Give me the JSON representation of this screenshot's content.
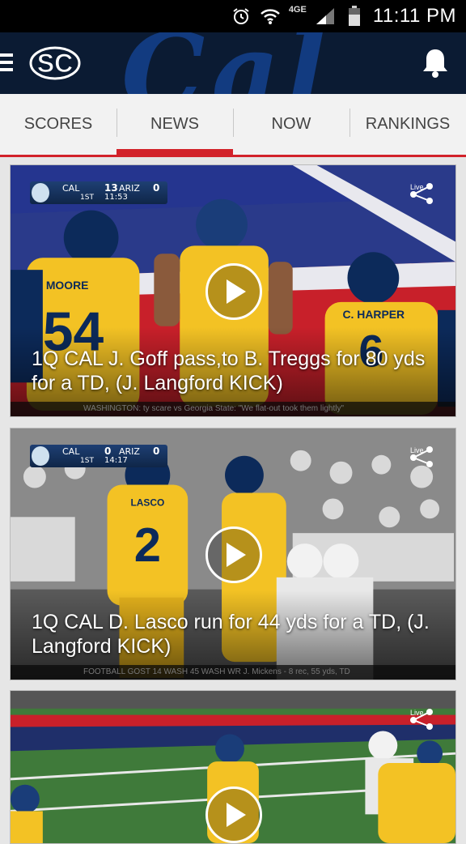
{
  "status_bar": {
    "time": "11:11 PM",
    "network": "4GE"
  },
  "app": {
    "logo": "SC",
    "watermark": "Cal"
  },
  "tabs": [
    {
      "label": "SCORES",
      "active": false
    },
    {
      "label": "NEWS",
      "active": true
    },
    {
      "label": "RANKINGS",
      "active": false
    }
  ],
  "tab_now": {
    "label": "NOW",
    "active": false
  },
  "cards": [
    {
      "headline": "1Q CAL J. Goff pass,to B. Treggs for 80 yds for a TD, (J. Langford KICK)",
      "scorebug": {
        "team1": "CAL",
        "score1": "13",
        "team2": "ARIZ",
        "score2": "0",
        "quarter": "1ST",
        "clock": "11:53"
      },
      "ticker": "WASHINGTON: ty scare vs Georgia State: \"We flat-out took them lightly\"",
      "share_label": "Live",
      "jerseys": [
        "54",
        "6"
      ],
      "player_names": [
        "MOORE",
        "C. HARPER"
      ]
    },
    {
      "headline": "1Q CAL D. Lasco run for 44 yds for a TD, (J. Langford KICK)",
      "scorebug": {
        "team1": "CAL",
        "score1": "0",
        "team2": "ARIZ",
        "score2": "0",
        "quarter": "1ST",
        "clock": "14:17"
      },
      "ticker": "FOOTBALL    GOST    14    WASH    45    WASH WR J. Mickens - 8 rec, 55 yds, TD",
      "share_label": "Live",
      "jerseys": [
        "2"
      ],
      "player_names": [
        "LASCO"
      ]
    },
    {
      "headline": "",
      "share_label": "Live"
    }
  ],
  "colors": {
    "accent": "#d2222a",
    "appbar": "#0b1b33",
    "cal_gold": "#f3c224",
    "cal_blue": "#0c2a5a"
  },
  "icons": {
    "menu": "hamburger-icon",
    "notifications": "bell-icon",
    "play": "play-icon",
    "share": "share-icon"
  }
}
